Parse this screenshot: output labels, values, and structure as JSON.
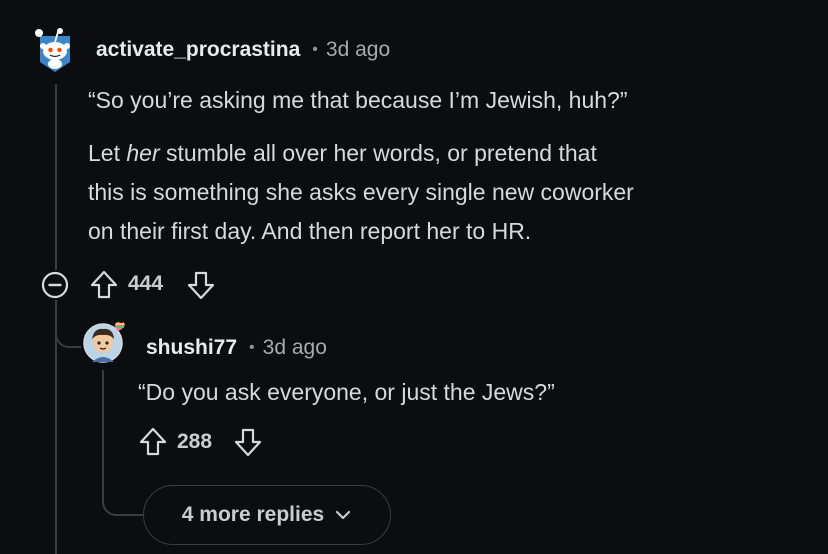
{
  "comment": {
    "username": "activate_procrastina",
    "timestamp": "3d ago",
    "quote": "“So you’re asking me that because I’m Jewish, huh?”",
    "body_prefix": "Let ",
    "body_em": "her",
    "body_line1_rest": " stumble all over her words, or pretend that",
    "body_line2": "this is something she asks every single new coworker",
    "body_line3": "on their first day. And then report her to HR.",
    "votes": "444"
  },
  "reply": {
    "username": "shushi77",
    "timestamp": "3d ago",
    "body": "“Do you ask everyone, or just the Jews?”",
    "votes": "288"
  },
  "more_replies_label": "4 more replies",
  "separator": "•",
  "icons": {
    "collapse": "minus-circle-icon",
    "upvote": "arrow-up-icon",
    "downvote": "arrow-down-icon",
    "expand": "chevron-down-icon"
  },
  "colors": {
    "background": "#0b0d10",
    "text": "#d7dadc",
    "meta": "#a7abaf",
    "thread_line": "#3a3d41"
  }
}
